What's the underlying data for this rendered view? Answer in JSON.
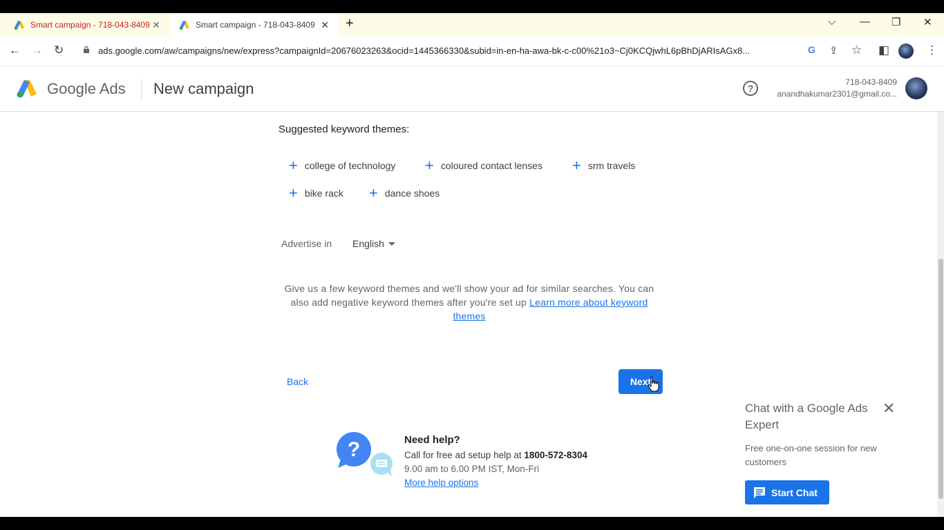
{
  "browser": {
    "tabs": [
      {
        "title": "Smart campaign - 718-043-8409",
        "active": false
      },
      {
        "title": "Smart campaign - 718-043-8409",
        "active": true
      }
    ],
    "new_tab": "+",
    "url": "ads.google.com/aw/campaigns/new/express?campaignId=20676023263&ocid=1445366330&subid=in-en-ha-awa-bk-c-c00%21o3~Cj0KCQjwhL6pBhDjARIsAGx8...",
    "icons": [
      "back-arrow",
      "forward-arrow",
      "reload",
      "lock",
      "google-g",
      "share",
      "star",
      "side-panel",
      "profile",
      "more-menu",
      "minimize",
      "restore",
      "close",
      "tab-search"
    ]
  },
  "header": {
    "brand_google": "Google",
    "brand_ads": "Ads",
    "page_title": "New campaign",
    "account_id": "718-043-8409",
    "account_email": "anandhakumar2301@gmail.co..."
  },
  "main": {
    "section_title": "Suggested keyword themes:",
    "keyword_themes": [
      "college of technology",
      "coloured contact lenses",
      "srm travels",
      "bike rack",
      "dance shoes"
    ],
    "advertise_label": "Advertise in",
    "language": "English",
    "description": "Give us a few keyword themes and we'll show your ad for similar searches. You can also add negative keyword themes after you're set up",
    "learn_more": "Learn more about keyword themes",
    "back_label": "Back",
    "next_label": "Next"
  },
  "help": {
    "title": "Need help?",
    "call_prefix": "Call for free ad setup help at",
    "phone": "1800-572-8304",
    "hours": "9.00 am to 6.00 PM IST, Mon-Fri",
    "more_options": "More help options"
  },
  "chat": {
    "title": "Chat with a Google Ads Expert",
    "description": "Free one-on-one session for new customers",
    "button_label": "Start Chat"
  },
  "colors": {
    "accent": "#1a73e8",
    "tab_strip": "#fdfde7",
    "inactive_tab_text": "#c5221f"
  }
}
